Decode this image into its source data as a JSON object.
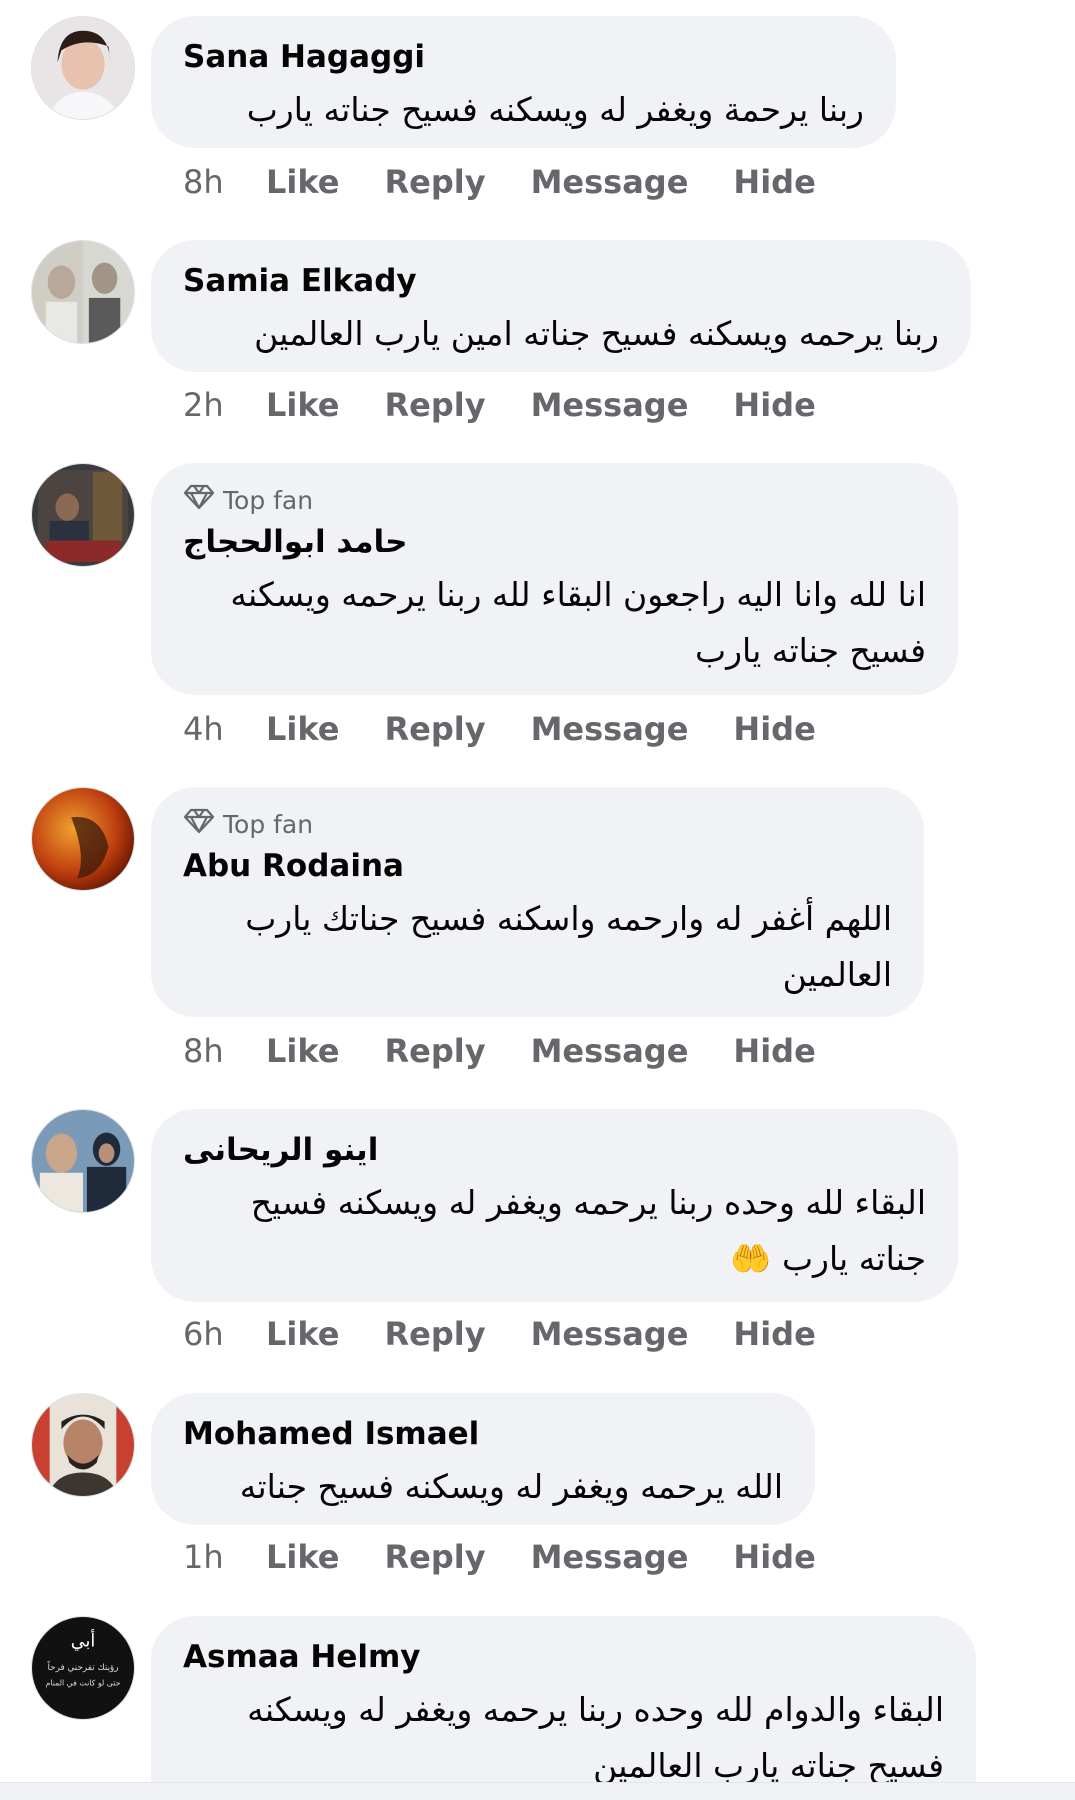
{
  "actions": {
    "like": "Like",
    "reply": "Reply",
    "message": "Message",
    "hide": "Hide"
  },
  "badge": {
    "top_fan": "Top fan"
  },
  "comments": [
    {
      "author": "Sana Hagaggi",
      "lines": [
        "ربنا يرحمة ويغفر له ويسكنه فسيح جناته يارب"
      ],
      "time": "8h"
    },
    {
      "author": "Samia Elkady",
      "lines": [
        "ربنا يرحمه ويسكنه فسيح جناته امين يارب العالمين"
      ],
      "time": "2h"
    },
    {
      "author": "حامد ابوالحجاج",
      "lines": [
        "انا لله وانا اليه راجعون البقاء لله ربنا يرحمه ويسكنه",
        "فسيح جناته يارب"
      ],
      "time": "4h",
      "top_fan": true
    },
    {
      "author": "Abu Rodaina",
      "lines": [
        "اللهم أغفر له وارحمه واسكنه فسيح جناتك يارب",
        "العالمين"
      ],
      "time": "8h",
      "top_fan": true
    },
    {
      "author": "اينو الريحانى",
      "lines": [
        "البقاء لله وحده ربنا يرحمه ويغفر له ويسكنه فسيح",
        "جناته يارب 🤲"
      ],
      "time": "6h"
    },
    {
      "author": "Mohamed Ismael",
      "lines": [
        "الله يرحمه ويغفر له ويسكنه فسيح جناته"
      ],
      "time": "1h"
    },
    {
      "author": "Asmaa Helmy",
      "lines": [
        "البقاء والدوام لله وحده ربنا يرحمه ويغفر له ويسكنه",
        "فسيح جناته يارب العالمين"
      ],
      "time": ""
    }
  ],
  "avatar_art": {
    "c7_lines": [
      "أبي",
      "رؤيتك تفرحني فرحاً",
      "حتى لو كانت في المنام"
    ]
  }
}
